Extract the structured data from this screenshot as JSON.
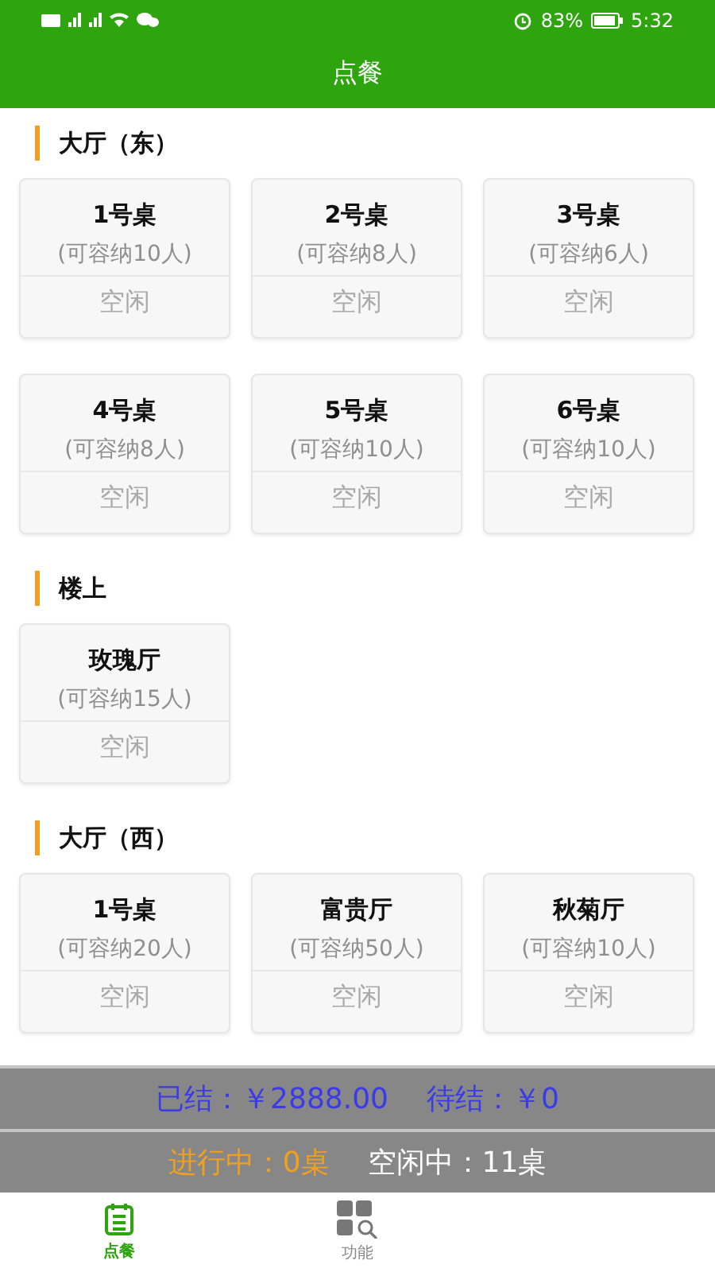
{
  "status_bar": {
    "battery": "83%",
    "time": "5:32"
  },
  "header": {
    "title": "点餐"
  },
  "sections": [
    {
      "title": "大厅（东）",
      "tables": [
        {
          "name": "1号桌",
          "capacity": "(可容纳10人)",
          "status": "空闲"
        },
        {
          "name": "2号桌",
          "capacity": "(可容纳8人)",
          "status": "空闲"
        },
        {
          "name": "3号桌",
          "capacity": "(可容纳6人)",
          "status": "空闲"
        },
        {
          "name": "4号桌",
          "capacity": "(可容纳8人)",
          "status": "空闲"
        },
        {
          "name": "5号桌",
          "capacity": "(可容纳10人)",
          "status": "空闲"
        },
        {
          "name": "6号桌",
          "capacity": "(可容纳10人)",
          "status": "空闲"
        }
      ]
    },
    {
      "title": "楼上",
      "tables": [
        {
          "name": "玫瑰厅",
          "capacity": "(可容纳15人)",
          "status": "空闲"
        }
      ]
    },
    {
      "title": "大厅（西）",
      "tables": [
        {
          "name": "1号桌",
          "capacity": "(可容纳20人)",
          "status": "空闲"
        },
        {
          "name": "富贵厅",
          "capacity": "(可容纳50人)",
          "status": "空闲"
        },
        {
          "name": "秋菊厅",
          "capacity": "(可容纳10人)",
          "status": "空闲"
        }
      ]
    }
  ],
  "summary": {
    "settled": "已结：￥2888.00",
    "pending": "待结：￥0",
    "in_progress": "进行中：0桌",
    "idle": "空闲中：11桌"
  },
  "bottom_nav": [
    {
      "label": "点餐",
      "kind": "order",
      "selected": true
    },
    {
      "label": "功能",
      "kind": "functions",
      "selected": false
    }
  ]
}
